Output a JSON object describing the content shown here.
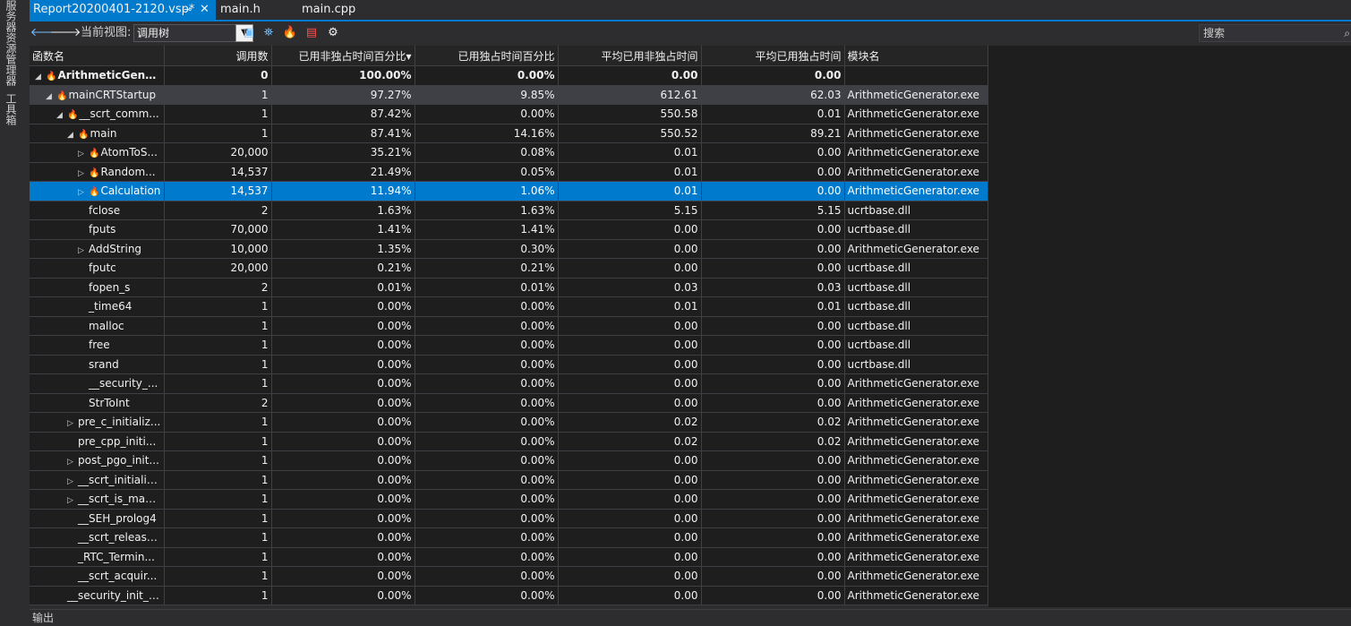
{
  "side_tabs": [
    "服务器资源管理器",
    "工具箱"
  ],
  "tabs": [
    {
      "label": "Report20200401-2120.vsp*",
      "active": true
    },
    {
      "label": "main.h",
      "active": false
    },
    {
      "label": "main.cpp",
      "active": false
    }
  ],
  "toolbar": {
    "view_label": "当前视图:",
    "view_value": "调用树",
    "search_placeholder": "搜索"
  },
  "columns": [
    "函数名",
    "调用数",
    "已用非独占时间百分比",
    "已用独占时间百分比",
    "平均已用非独占时间",
    "平均已用独占时间",
    "模块名"
  ],
  "rows": [
    {
      "name": "ArithmeticGener...",
      "calls": "0",
      "incl": "100.00%",
      "excl": "0.00%",
      "avg_incl": "0.00",
      "avg_excl": "0.00",
      "module": ""
    },
    {
      "name": "mainCRTStartup",
      "calls": "1",
      "incl": "97.27%",
      "excl": "9.85%",
      "avg_incl": "612.61",
      "avg_excl": "62.03",
      "module": "ArithmeticGenerator.exe"
    },
    {
      "name": "__scrt_comm...",
      "calls": "1",
      "incl": "87.42%",
      "excl": "0.00%",
      "avg_incl": "550.58",
      "avg_excl": "0.01",
      "module": "ArithmeticGenerator.exe"
    },
    {
      "name": "main",
      "calls": "1",
      "incl": "87.41%",
      "excl": "14.16%",
      "avg_incl": "550.52",
      "avg_excl": "89.21",
      "module": "ArithmeticGenerator.exe"
    },
    {
      "name": "AtomToS...",
      "calls": "20,000",
      "incl": "35.21%",
      "excl": "0.08%",
      "avg_incl": "0.01",
      "avg_excl": "0.00",
      "module": "ArithmeticGenerator.exe"
    },
    {
      "name": "Random...",
      "calls": "14,537",
      "incl": "21.49%",
      "excl": "0.05%",
      "avg_incl": "0.01",
      "avg_excl": "0.00",
      "module": "ArithmeticGenerator.exe"
    },
    {
      "name": "Calculation",
      "calls": "14,537",
      "incl": "11.94%",
      "excl": "1.06%",
      "avg_incl": "0.01",
      "avg_excl": "0.00",
      "module": "ArithmeticGenerator.exe"
    },
    {
      "name": "fclose",
      "calls": "2",
      "incl": "1.63%",
      "excl": "1.63%",
      "avg_incl": "5.15",
      "avg_excl": "5.15",
      "module": "ucrtbase.dll"
    },
    {
      "name": "fputs",
      "calls": "70,000",
      "incl": "1.41%",
      "excl": "1.41%",
      "avg_incl": "0.00",
      "avg_excl": "0.00",
      "module": "ucrtbase.dll"
    },
    {
      "name": "AddString",
      "calls": "10,000",
      "incl": "1.35%",
      "excl": "0.30%",
      "avg_incl": "0.00",
      "avg_excl": "0.00",
      "module": "ArithmeticGenerator.exe"
    },
    {
      "name": "fputc",
      "calls": "20,000",
      "incl": "0.21%",
      "excl": "0.21%",
      "avg_incl": "0.00",
      "avg_excl": "0.00",
      "module": "ucrtbase.dll"
    },
    {
      "name": "fopen_s",
      "calls": "2",
      "incl": "0.01%",
      "excl": "0.01%",
      "avg_incl": "0.03",
      "avg_excl": "0.03",
      "module": "ucrtbase.dll"
    },
    {
      "name": "_time64",
      "calls": "1",
      "incl": "0.00%",
      "excl": "0.00%",
      "avg_incl": "0.01",
      "avg_excl": "0.01",
      "module": "ucrtbase.dll"
    },
    {
      "name": "malloc",
      "calls": "1",
      "incl": "0.00%",
      "excl": "0.00%",
      "avg_incl": "0.00",
      "avg_excl": "0.00",
      "module": "ucrtbase.dll"
    },
    {
      "name": "free",
      "calls": "1",
      "incl": "0.00%",
      "excl": "0.00%",
      "avg_incl": "0.00",
      "avg_excl": "0.00",
      "module": "ucrtbase.dll"
    },
    {
      "name": "srand",
      "calls": "1",
      "incl": "0.00%",
      "excl": "0.00%",
      "avg_incl": "0.00",
      "avg_excl": "0.00",
      "module": "ucrtbase.dll"
    },
    {
      "name": "__security_...",
      "calls": "1",
      "incl": "0.00%",
      "excl": "0.00%",
      "avg_incl": "0.00",
      "avg_excl": "0.00",
      "module": "ArithmeticGenerator.exe"
    },
    {
      "name": "StrToInt",
      "calls": "2",
      "incl": "0.00%",
      "excl": "0.00%",
      "avg_incl": "0.00",
      "avg_excl": "0.00",
      "module": "ArithmeticGenerator.exe"
    },
    {
      "name": "pre_c_initializ...",
      "calls": "1",
      "incl": "0.00%",
      "excl": "0.00%",
      "avg_incl": "0.02",
      "avg_excl": "0.02",
      "module": "ArithmeticGenerator.exe"
    },
    {
      "name": "pre_cpp_initi...",
      "calls": "1",
      "incl": "0.00%",
      "excl": "0.00%",
      "avg_incl": "0.02",
      "avg_excl": "0.02",
      "module": "ArithmeticGenerator.exe"
    },
    {
      "name": "post_pgo_init...",
      "calls": "1",
      "incl": "0.00%",
      "excl": "0.00%",
      "avg_incl": "0.00",
      "avg_excl": "0.00",
      "module": "ArithmeticGenerator.exe"
    },
    {
      "name": "__scrt_initializ...",
      "calls": "1",
      "incl": "0.00%",
      "excl": "0.00%",
      "avg_incl": "0.00",
      "avg_excl": "0.00",
      "module": "ArithmeticGenerator.exe"
    },
    {
      "name": "__scrt_is_man...",
      "calls": "1",
      "incl": "0.00%",
      "excl": "0.00%",
      "avg_incl": "0.00",
      "avg_excl": "0.00",
      "module": "ArithmeticGenerator.exe"
    },
    {
      "name": "__SEH_prolog4",
      "calls": "1",
      "incl": "0.00%",
      "excl": "0.00%",
      "avg_incl": "0.00",
      "avg_excl": "0.00",
      "module": "ArithmeticGenerator.exe"
    },
    {
      "name": "__scrt_release...",
      "calls": "1",
      "incl": "0.00%",
      "excl": "0.00%",
      "avg_incl": "0.00",
      "avg_excl": "0.00",
      "module": "ArithmeticGenerator.exe"
    },
    {
      "name": "_RTC_Termin...",
      "calls": "1",
      "incl": "0.00%",
      "excl": "0.00%",
      "avg_incl": "0.00",
      "avg_excl": "0.00",
      "module": "ArithmeticGenerator.exe"
    },
    {
      "name": "__scrt_acquir...",
      "calls": "1",
      "incl": "0.00%",
      "excl": "0.00%",
      "avg_incl": "0.00",
      "avg_excl": "0.00",
      "module": "ArithmeticGenerator.exe"
    },
    {
      "name": "__security_init_c...",
      "calls": "1",
      "incl": "0.00%",
      "excl": "0.00%",
      "avg_incl": "0.00",
      "avg_excl": "0.00",
      "module": "ArithmeticGenerator.exe"
    }
  ],
  "bottom_panel": {
    "label": "输出"
  },
  "colors": {
    "accent": "#007acc",
    "hot_path": "#ff4d4d",
    "background": "#1e1e1e"
  }
}
